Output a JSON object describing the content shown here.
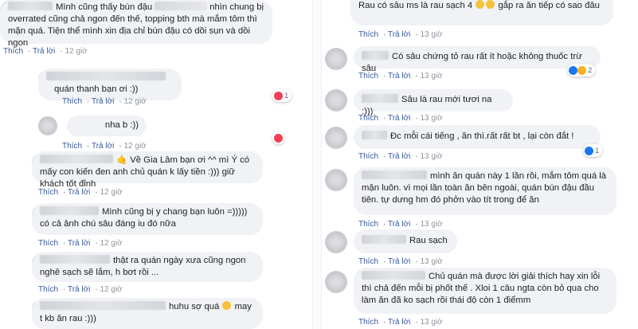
{
  "actions": {
    "like": "Thích",
    "reply": "Trả lời"
  },
  "left": [
    {
      "text_a": "Mình cũng thấy bún đậu",
      "text_b": "nhìn chung bị overrated cũng chả ngon đến thế, topping bth mà mắm tôm thì mặn quá. Tiện thể mình xin địa chỉ bún đậu có dồi sụn và dồi ngon",
      "time": "12 giờ"
    },
    {
      "text": "quán thanh bạn ơi :))",
      "time": "12 giờ",
      "reaction_count": "1"
    },
    {
      "text": "nha b :))",
      "time": "12 giờ"
    },
    {
      "text_a": "🤙 Về Gia Lâm bạn ơi ^^ mì Ý có mấy con kiến đen anh chủ quán k lấy tiền :))) giữ khách tốt đỉnh",
      "time": "12 giờ"
    },
    {
      "text": "Mình cũng bị y chang bạn luôn =))))) có cả ảnh chú sâu đáng iu đó nữa",
      "time": "12 giờ"
    },
    {
      "text": "thật ra quán ngày xưa cũng ngon nghê sạch sẽ lắm, h bơt rồi ...",
      "time": "12 giờ"
    },
    {
      "text_a": "huhu sợ quá",
      "text_b": "may t kb ăn rau :)))"
    }
  ],
  "right": [
    {
      "text_a": "Rau có sâu ms là rau sạch 4",
      "text_b": "gắp ra ăn tiếp có sao đâu",
      "time": "13 giờ"
    },
    {
      "text": "Có sâu chứng tỏ rau rất ít hoặc không thuốc trừ sâu",
      "time": "13 giờ",
      "reaction_count": "2"
    },
    {
      "text": "Sâu là rau mới tươi na :)))",
      "time": "13 giờ"
    },
    {
      "text": "Đc mỗi cái tiếng , ăn thì.rất rất bt , lại còn đắt !",
      "time": "13 giờ",
      "reaction_count": "1"
    },
    {
      "text": "mình ăn quán này 1 lần rồi, mắm tôm quá là mặn luôn. vì mọi lần toàn ăn bên ngoài, quán bún đậu đầu tiên. tự dưng hm đó phởn vào tít trong để ăn",
      "time": "13 giờ"
    },
    {
      "text": "Rau sạch",
      "time": "13 giờ"
    },
    {
      "text": "Chủ quán mà được lời giải thích hay xin lỗi thì chả đến mỗi bị phốt thế . Xloi 1 câu ngta còn bỏ qua cho làm ăn đã ko sạch rồi thái độ còn 1 điểmm",
      "time": "13 giờ"
    }
  ],
  "colors": {
    "bubble": "#f0f2f5",
    "link": "#385898",
    "heart": "#f33e58",
    "like": "#1877f2"
  }
}
